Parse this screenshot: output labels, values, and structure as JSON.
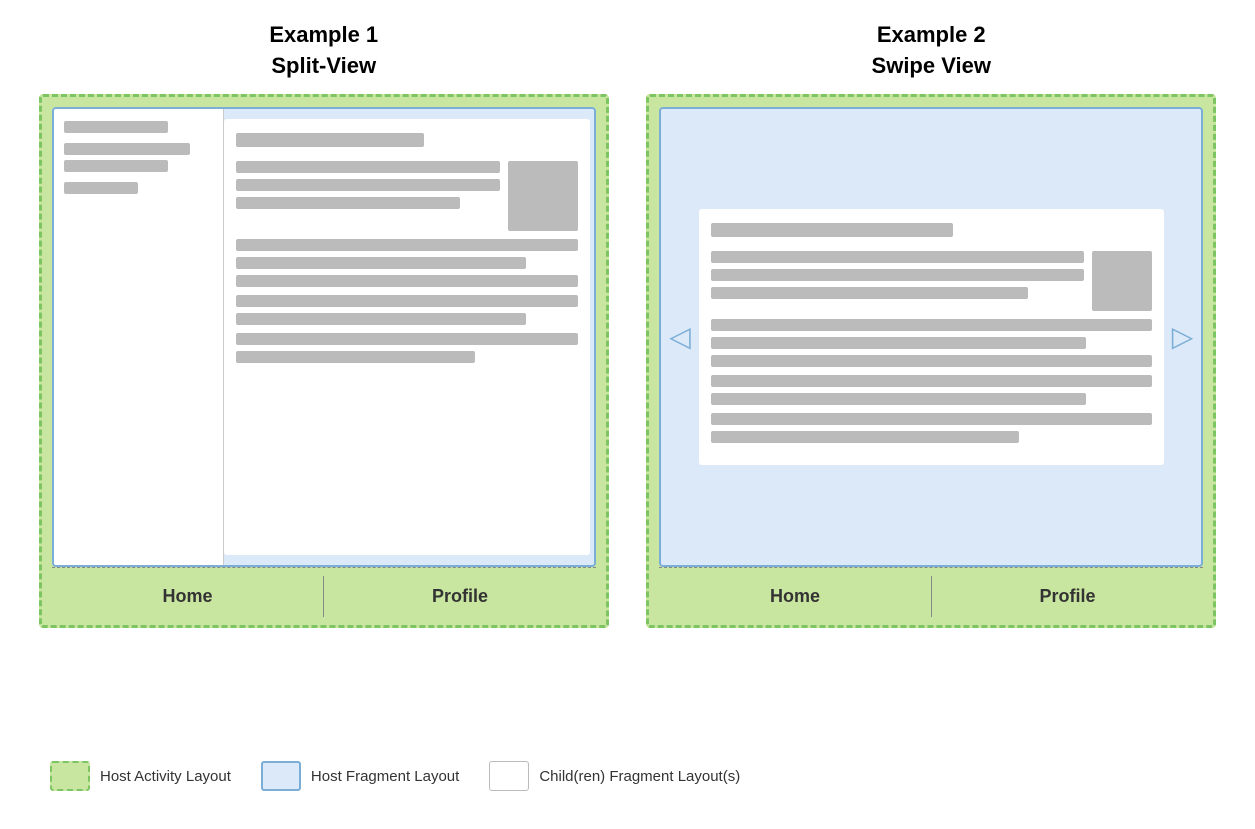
{
  "example1": {
    "title_line1": "Example 1",
    "title_line2": "Split-View",
    "nav_home": "Home",
    "nav_profile": "Profile"
  },
  "example2": {
    "title_line1": "Example 2",
    "title_line2": "Swipe View",
    "nav_home": "Home",
    "nav_profile": "Profile"
  },
  "legend": {
    "item1_label": "Host Activity Layout",
    "item2_label": "Host Fragment Layout",
    "item3_label": "Child(ren) Fragment Layout(s)"
  },
  "arrows": {
    "left": "◁",
    "right": "▷"
  }
}
